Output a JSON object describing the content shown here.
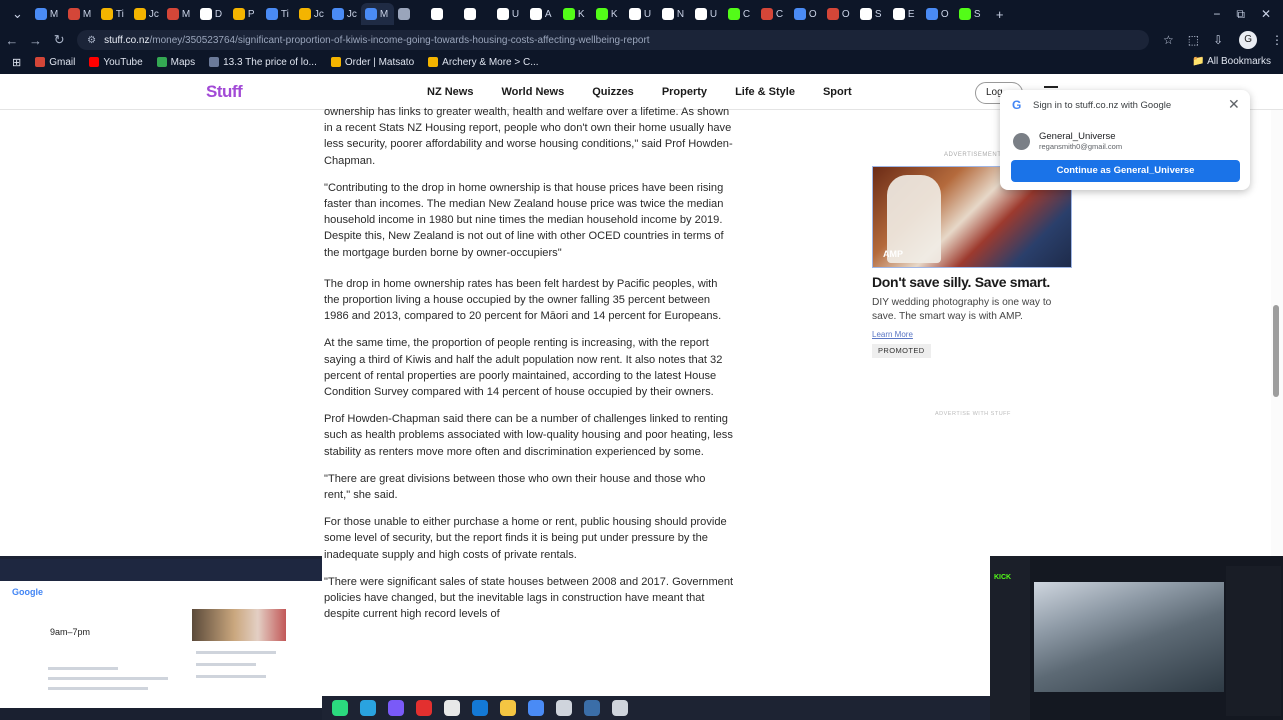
{
  "browser": {
    "tabs": [
      {
        "label": "M",
        "color": "#4a8bf5"
      },
      {
        "label": "M",
        "color": "#d44638"
      },
      {
        "label": "Ti",
        "color": "#f4b400"
      },
      {
        "label": "Jc",
        "color": "#f4b400"
      },
      {
        "label": "M",
        "color": "#d44638"
      },
      {
        "label": "D",
        "color": "#ffffff"
      },
      {
        "label": "P",
        "color": "#f4b400"
      },
      {
        "label": "Ti",
        "color": "#4a8bf5"
      },
      {
        "label": "Jc",
        "color": "#f4b400"
      },
      {
        "label": "Jc",
        "color": "#4a8bf5"
      },
      {
        "label": "M",
        "color": "#4a8bf5"
      },
      {
        "label": "",
        "color": "#9aa5bb"
      },
      {
        "label": "",
        "color": "#ffffff"
      },
      {
        "label": "",
        "color": "#ffffff"
      },
      {
        "label": "U",
        "color": "#ffffff"
      },
      {
        "label": "A",
        "color": "#ffffff"
      },
      {
        "label": "K",
        "color": "#53fc18"
      },
      {
        "label": "K",
        "color": "#53fc18"
      },
      {
        "label": "U",
        "color": "#ffffff"
      },
      {
        "label": "N",
        "color": "#ffffff"
      },
      {
        "label": "U",
        "color": "#ffffff"
      },
      {
        "label": "C",
        "color": "#53fc18"
      },
      {
        "label": "C",
        "color": "#d44638"
      },
      {
        "label": "O",
        "color": "#4a8bf5"
      },
      {
        "label": "O",
        "color": "#d44638"
      },
      {
        "label": "S",
        "color": "#ffffff"
      },
      {
        "label": "E",
        "color": "#ffffff"
      },
      {
        "label": "O",
        "color": "#4a8bf5"
      },
      {
        "label": "S",
        "color": "#53fc18"
      }
    ],
    "new_tab": "+",
    "window_controls": [
      "−",
      "⧉",
      "✕"
    ],
    "url_host": "stuff.co.nz",
    "url_path": "/money/350523764/significant-proportion-of-kiwis-income-going-towards-housing-costs-affecting-wellbeing-report",
    "bookmarks": [
      {
        "label": "Gmail",
        "color": "#d44638"
      },
      {
        "label": "YouTube",
        "color": "#ff0000"
      },
      {
        "label": "Maps",
        "color": "#34a853"
      },
      {
        "label": "13.3 The price of lo...",
        "color": "#6b7a99"
      },
      {
        "label": "Order | Matsato",
        "color": "#f4b400"
      },
      {
        "label": "Archery & More > C...",
        "color": "#f4b400"
      }
    ],
    "all_bookmarks": "All Bookmarks",
    "profile_initial": "G"
  },
  "site": {
    "logo": "Stuff",
    "nav": [
      "NZ News",
      "World News",
      "Quizzes",
      "Property",
      "Life & Style",
      "Sport"
    ],
    "login": "Log"
  },
  "article": {
    "paragraphs": [
      "ownership has links to greater wealth, health and welfare over a lifetime. As shown in a recent Stats NZ Housing report, people who don't own their home usually have less security, poorer affordability and worse housing conditions,\" said Prof Howden-Chapman.",
      "\"Contributing to the drop in home ownership is that house prices have been rising faster than incomes. The median New Zealand house price was twice the median household income in 1980 but nine times the median household income by 2019. Despite this, New Zealand is not out of line with other OCED countries in terms of the mortgage burden borne by owner-occupiers\"",
      "The drop in home ownership rates has been felt hardest by Pacific peoples, with the proportion living a house occupied by the owner falling 35 percent between 1986 and 2013, compared to 20 percent for Māori and 14 percent for Europeans.",
      "At the same time, the proportion of people renting is increasing, with the report saying a third of Kiwis and half the adult population now rent. It also notes that 32 percent of rental properties are poorly maintained, according to the latest House Condition Survey compared with 14 percent of house occupied by their owners.",
      "Prof Howden-Chapman said there can be a number of challenges linked to renting such as health problems associated with low-quality housing and poor heating, less stability as renters move more often and discrimination experienced by some.",
      "\"There are great divisions between those who own their house and those who rent,\" she said.",
      "For those unable to either purchase a home or rent, public housing should provide some level of security, but the report finds it is being put under pressure by the inadequate supply and high costs of private rentals.",
      "\"There were significant sales of state houses between 2008 and 2017. Government policies have changed, but the inevitable lags in construction have meant that despite current high record levels of"
    ]
  },
  "ad": {
    "label": "ADVERTISEMENT",
    "image_text": "AMP",
    "title": "Don't save silly. Save smart.",
    "description": "DIY wedding photography is one way to save. The smart way is with AMP.",
    "learn_more": "Learn More",
    "promoted": "PROMOTED",
    "advertise": "ADVERTISE WITH STUFF"
  },
  "google_signin": {
    "title": "Sign in to stuff.co.nz with Google",
    "account_name": "General_Universe",
    "account_email": "regansmith0@gmail.com",
    "continue_label": "Continue as General_Universe"
  },
  "pip_left": {
    "search_title": "Google",
    "hours": "9am–7pm"
  },
  "pip_right": {
    "live_label": "KICK"
  },
  "taskbar": {
    "icons": [
      {
        "name": "chat-app-icon",
        "color": "#2bd97e"
      },
      {
        "name": "telegram-icon",
        "color": "#2aa3e0"
      },
      {
        "name": "discord-icon",
        "color": "#7a5af8"
      },
      {
        "name": "bolt-app-icon",
        "color": "#e3302f"
      },
      {
        "name": "calendar-icon",
        "color": "#e8e8e8"
      },
      {
        "name": "outlook-icon",
        "color": "#1479d6"
      },
      {
        "name": "file-explorer-icon",
        "color": "#f4c542"
      },
      {
        "name": "chrome-icon",
        "color": "#4a8bf5"
      },
      {
        "name": "feather-app-icon",
        "color": "#cfd4dc"
      },
      {
        "name": "steam-icon",
        "color": "#3b6ea8"
      },
      {
        "name": "settings-icon",
        "color": "#cfd4dc"
      }
    ]
  }
}
